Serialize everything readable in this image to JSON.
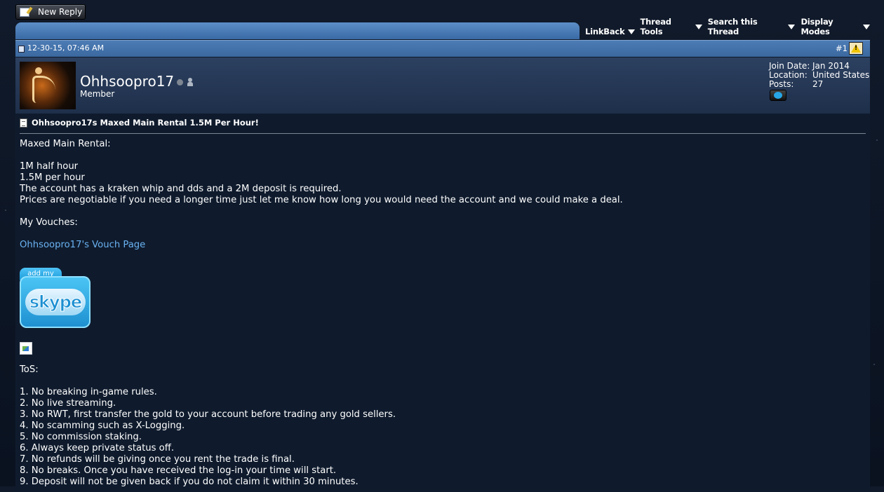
{
  "toolbar": {
    "new_reply_label": "New Reply",
    "menus": [
      {
        "label": "LinkBack"
      },
      {
        "label": "Thread Tools"
      },
      {
        "label": "Search this Thread"
      },
      {
        "label": "Display Modes"
      }
    ]
  },
  "post": {
    "date": "12-30-15, 07:46 AM",
    "number": "#1",
    "user": {
      "name": "Ohhsoopro17",
      "title": "Member",
      "join_date_label": "Join Date:",
      "join_date": "Jan 2014",
      "location_label": "Location:",
      "location": "United States",
      "posts_label": "Posts:",
      "posts": "27"
    },
    "title": "Ohhsoopro17s Maxed Main Rental 1.5M Per Hour!",
    "lines_top": [
      "Maxed Main Rental:",
      "",
      "1M half hour",
      "1.5M per hour",
      "The account has a kraken whip and dds and a 2M deposit is required.",
      "Prices are negotiable if you need a longer time just let me know how long you would need the account and we could make a deal.",
      "",
      "My Vouches:",
      ""
    ],
    "vouch_link": "Ohhsoopro17's Vouch Page",
    "skype_badge": {
      "tab": "add my",
      "logo": "skype"
    },
    "tos_heading": "ToS:",
    "tos": [
      "1. No breaking in-game rules.",
      "2. No live streaming.",
      "3. No RWT, first transfer the gold to your account before trading any gold sellers.",
      "4. No scamming such as X-Logging.",
      "5. No commission staking.",
      "6. Always keep private status off.",
      "7. No refunds will be giving once you rent the trade is final.",
      "8. No breaks. Once you have received the log-in your time will start.",
      "9. Deposit will not be given back if you do not claim it within 30 minutes."
    ]
  }
}
